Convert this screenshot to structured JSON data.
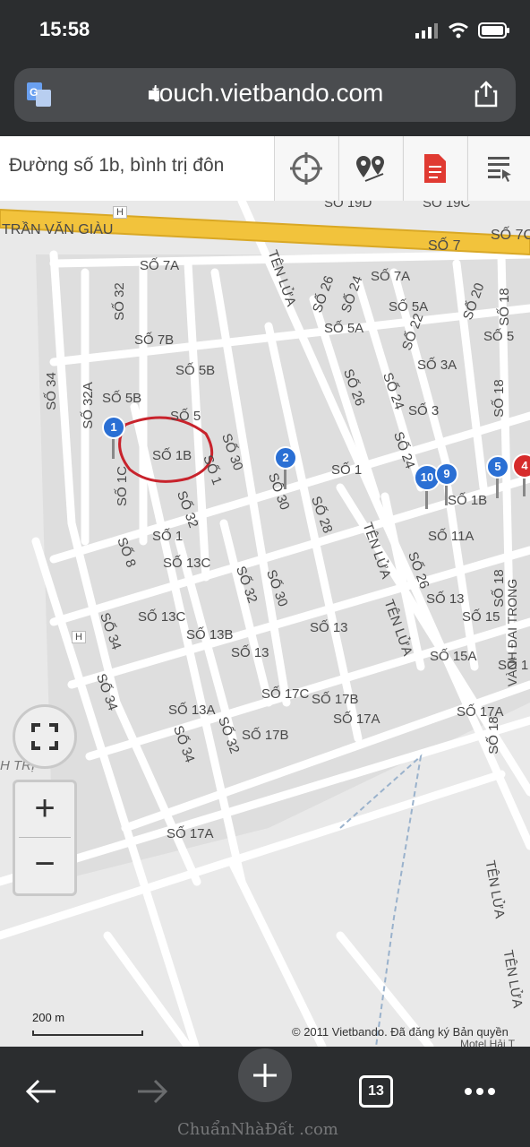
{
  "status_bar": {
    "time": "15:58"
  },
  "browser": {
    "url": "touch.vietbando.com",
    "tab_count": "13"
  },
  "toolbar": {
    "search_value": "Đường số 1b, bình trị đôn"
  },
  "map": {
    "roads": [
      "TRẦN VĂN GIÀU",
      "SỐ 7A",
      "SỐ 7",
      "SỐ 7C",
      "SỐ 19C",
      "SỐ 19D",
      "TÊN LỬA",
      "SỐ 32",
      "SỐ 34",
      "SỐ 32A",
      "SỐ 7B",
      "SỐ 5B",
      "SỐ 5B",
      "SỐ 5",
      "SỐ 1B",
      "SỐ 30",
      "SỐ 1",
      "SỐ 1C",
      "SỐ 32",
      "SỐ 8",
      "SỐ 1",
      "SỐ 13C",
      "SỐ 13C",
      "SỐ 34",
      "SỐ 13B",
      "SỐ 13",
      "SỐ 30",
      "SỐ 32",
      "SỐ 34",
      "SỐ 13A",
      "SỐ 32",
      "SỐ 34",
      "SỐ 17B",
      "SỐ 17C",
      "SỐ 17B",
      "SỐ 17A",
      "SỐ 17A",
      "SỐ 26",
      "SỐ 24",
      "SỐ 5A",
      "SỐ 7A",
      "SỐ 5A",
      "SỐ 22",
      "SỐ 20",
      "SỐ 18",
      "SỐ 5",
      "SỐ 3A",
      "SỐ 26",
      "SỐ 24",
      "SỐ 3",
      "SỐ 18",
      "SỐ 24",
      "SỐ 1",
      "SỐ 30",
      "SỐ 28",
      "TÊN LỬA",
      "SỐ 1B",
      "SỐ 11A",
      "SỐ 26",
      "SỐ 13",
      "SỐ 18",
      "SỐ 15",
      "SỐ 13",
      "TÊN LỬA",
      "SỐ 15A",
      "SỐ 1",
      "SỐ 17A",
      "SỐ 18",
      "TÊN LỬA",
      "TÊN LỬA",
      "VÀNH ĐAI TRONG",
      "H TRỊ"
    ],
    "markers": [
      "1",
      "2",
      "10",
      "9",
      "5",
      "4"
    ],
    "poi_marker": "H",
    "scale": "200 m",
    "copyright": "© 2011 Vietbando. Đã đăng ký Bản quyền",
    "poi_partial": "Motel Hải T"
  },
  "controls": {
    "zoom_in": "+",
    "zoom_out": "−"
  },
  "watermark": "ChuẩnNhàĐất .com",
  "colors": {
    "main_road": "#f2c33c",
    "marker_blue": "#2a6fd4",
    "marker_red": "#d62b2b",
    "annotation": "#c8232c"
  }
}
